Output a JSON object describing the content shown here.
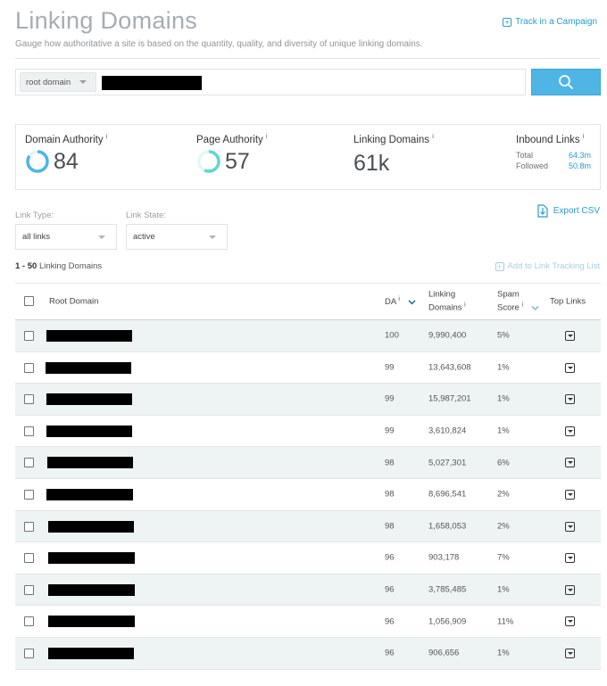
{
  "header": {
    "title": "Linking Domains",
    "subtitle": "Gauge how authoritative a site is based on the quantity, quality, and diversity of unique linking domains.",
    "track_label": "Track in a Campaign"
  },
  "search": {
    "scope_label": "root domain"
  },
  "metrics": {
    "domain_authority": {
      "label": "Domain Authority",
      "value": "84",
      "ring": 0.84,
      "color": "#4fb5e4"
    },
    "page_authority": {
      "label": "Page Authority",
      "value": "57",
      "ring": 0.57,
      "color": "#5fd6d0"
    },
    "linking_domains": {
      "label": "Linking Domains",
      "value": "61k"
    },
    "inbound_links": {
      "label": "Inbound Links",
      "total_label": "Total",
      "total_value": "64.3m",
      "followed_label": "Followed",
      "followed_value": "50.8m"
    },
    "info_glyph": "i"
  },
  "filters": {
    "link_type_label": "Link Type:",
    "link_type_value": "all links",
    "link_state_label": "Link State:",
    "link_state_value": "active",
    "export_label": "Export CSV"
  },
  "results": {
    "count_range": "1 - 50",
    "count_label": "Linking Domains",
    "add_tracking_label": "Add to Link Tracking List"
  },
  "table": {
    "headers": {
      "root_domain": "Root Domain",
      "da": "DA",
      "linking_domains_1": "Linking",
      "linking_domains_2": "Domains",
      "spam_1": "Spam",
      "spam_2": "Score",
      "top_links": "Top Links"
    },
    "rows": [
      {
        "da": "100",
        "linking_domains": "9,990,400",
        "spam": "5%"
      },
      {
        "da": "99",
        "linking_domains": "13,643,608",
        "spam": "1%"
      },
      {
        "da": "99",
        "linking_domains": "15,987,201",
        "spam": "1%"
      },
      {
        "da": "99",
        "linking_domains": "3,610,824",
        "spam": "1%"
      },
      {
        "da": "98",
        "linking_domains": "5,027,301",
        "spam": "6%"
      },
      {
        "da": "98",
        "linking_domains": "8,696,541",
        "spam": "2%"
      },
      {
        "da": "98",
        "linking_domains": "1,658,053",
        "spam": "2%"
      },
      {
        "da": "96",
        "linking_domains": "903,178",
        "spam": "7%"
      },
      {
        "da": "96",
        "linking_domains": "3,785,485",
        "spam": "1%"
      },
      {
        "da": "96",
        "linking_domains": "1,056,909",
        "spam": "11%"
      },
      {
        "da": "96",
        "linking_domains": "906,656",
        "spam": "1%"
      }
    ]
  },
  "colors": {
    "accent": "#2b9bc8",
    "search_button": "#4fb5e4",
    "row_alt": "#eef4f4"
  }
}
